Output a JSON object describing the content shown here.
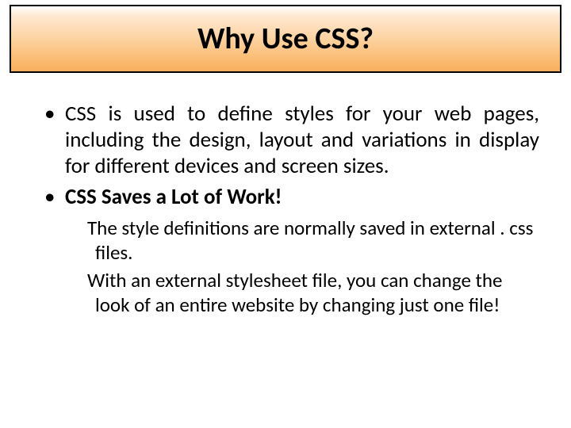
{
  "title": "Why Use CSS?",
  "bullets": [
    {
      "text": "CSS is used to define styles for your web pages, including the design, layout and variations in display for different devices and screen sizes.",
      "bold": false
    },
    {
      "text": "CSS Saves a Lot of Work!",
      "bold": true
    }
  ],
  "sub": [
    "The style definitions are normally saved in external . css files.",
    "With an external stylesheet file, you can change the look of an entire website by changing just one file!"
  ]
}
